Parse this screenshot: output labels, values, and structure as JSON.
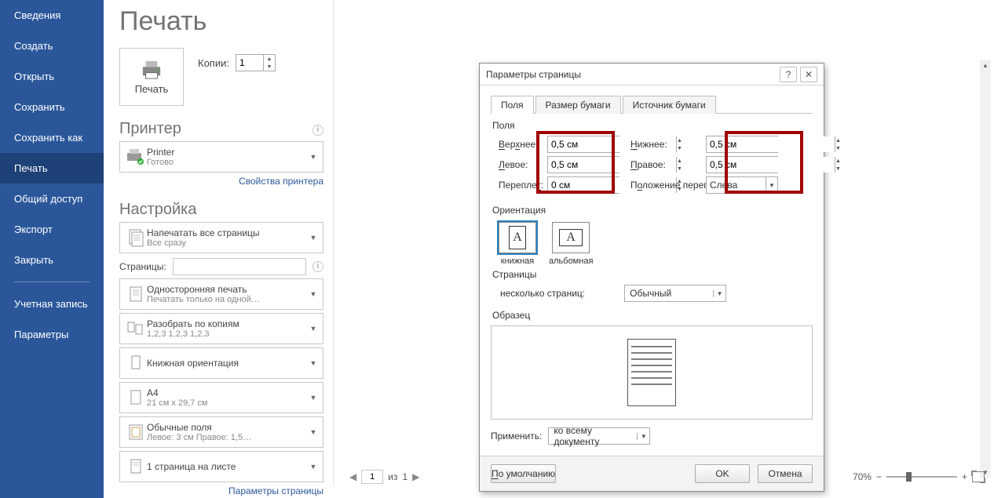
{
  "sidebar": {
    "items": [
      {
        "label": "Сведения"
      },
      {
        "label": "Создать"
      },
      {
        "label": "Открыть"
      },
      {
        "label": "Сохранить"
      },
      {
        "label": "Сохранить как"
      },
      {
        "label": "Печать"
      },
      {
        "label": "Общий доступ"
      },
      {
        "label": "Экспорт"
      },
      {
        "label": "Закрыть"
      }
    ],
    "items2": [
      {
        "label": "Учетная запись"
      },
      {
        "label": "Параметры"
      }
    ],
    "selected": 5
  },
  "title": "Печать",
  "print_button": "Печать",
  "copies_label": "Копии:",
  "copies_value": "1",
  "printer_section": "Принтер",
  "printer": {
    "name": "Printer",
    "status": "Готово"
  },
  "printer_props_link": "Свойства принтера",
  "settings_section": "Настройка",
  "dd_allpages": {
    "l1": "Напечатать все страницы",
    "l2": "Все сразу"
  },
  "pages_label": "Страницы:",
  "dd_oneside": {
    "l1": "Односторонняя печать",
    "l2": "Печатать только на одной…"
  },
  "dd_collate": {
    "l1": "Разобрать по копиям",
    "l2": "1,2,3   1,2,3   1,2,3"
  },
  "dd_orient": {
    "l1": "Книжная ориентация"
  },
  "dd_paper": {
    "l1": "A4",
    "l2": "21 см x 29,7 см"
  },
  "dd_margins": {
    "l1": "Обычные поля",
    "l2": "Левое:  3 см   Правое:  1,5…"
  },
  "dd_perpage": {
    "l1": "1 страница на листе"
  },
  "page_setup_link": "Параметры страницы",
  "nav": {
    "page": "1",
    "of_label": "из",
    "of_total": "1",
    "zoom": "70%"
  },
  "dialog": {
    "title": "Параметры страницы",
    "tabs": [
      "Поля",
      "Размер бумаги",
      "Источник бумаги"
    ],
    "active_tab": 0,
    "fields_label": "Поля",
    "top_label": "Верхнее:",
    "top_val": "0,5 см",
    "bottom_label": "Нижнее:",
    "bottom_val": "0,5 см",
    "left_label": "Левое:",
    "left_val": "0,5 см",
    "right_label": "Правое:",
    "right_val": "0,5 см",
    "gutter_label": "Переплет:",
    "gutter_val": "0 см",
    "gutter_pos_label": "Положение переплета:",
    "gutter_pos_val": "Слева",
    "orient_label": "Ориентация",
    "orient_portrait": "книжная",
    "orient_landscape": "альбомная",
    "pages_grp": "Страницы",
    "multipage_label": "несколько страниц:",
    "multipage_val": "Обычный",
    "sample_label": "Образец",
    "apply_label": "Применить:",
    "apply_val": "ко всему документу",
    "defaults_btn": "По умолчанию",
    "ok_btn": "OK",
    "cancel_btn": "Отмена"
  }
}
